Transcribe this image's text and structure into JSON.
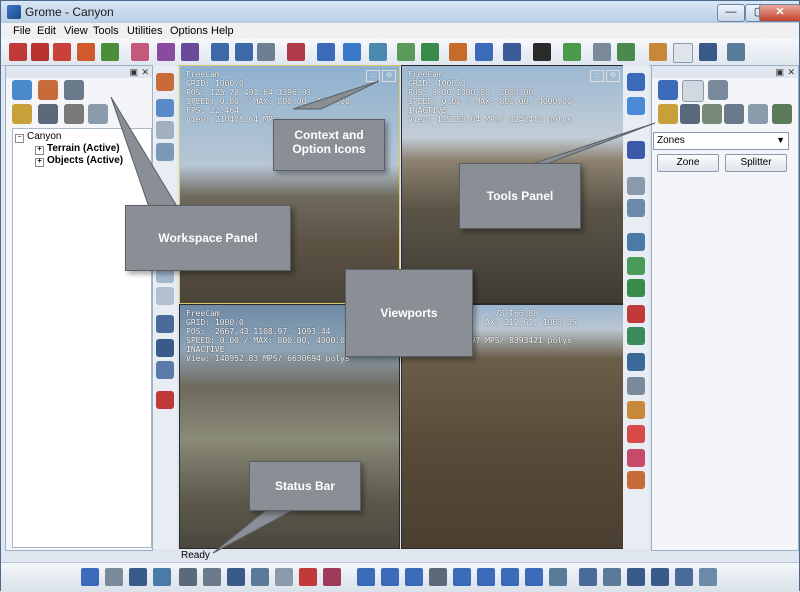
{
  "window": {
    "title": "Grome - Canyon",
    "minimize": "—",
    "maximize": "▢",
    "close": "✕"
  },
  "menu": [
    "File",
    "Edit",
    "View",
    "Tools",
    "Utilities",
    "Options",
    "Help"
  ],
  "workspace": {
    "tree": {
      "root": "Canyon",
      "children": [
        "Terrain (Active)",
        "Objects (Active)"
      ]
    }
  },
  "viewports": [
    {
      "lines": "FreeCam\nGRID: 1000.0\nPOS: 125.78 491.64 1396.93\nSPEED: 0.00 / MAX: 800.00, 4000.00\nFPS: 22.464\nView: 210405.64 MPS/"
    },
    {
      "lines": "FreeCam\nGRID: 1000.0\nPOS: 9.00 1000.00 -2000.00\nSPEED: 0.00 / MAX: 800.00, 4000.00\nINACTIVE\nView: 185158.64 MPS/ 8242410 polys"
    },
    {
      "lines": "FreeCam\nGRID: 1000.0\nPOS: -2667.43 1108.97 -1093.44\nSPEED: 0.00 / MAX: 800.00, 4000.00\nINACTIVE\nView: 148952.83 MPS/ 6630694 polys"
    },
    {
      "lines": "                 .78 166.89\n                AX: 212.61, 1063.05\n\nView: 186083.97 MPS/ 8393421 polys"
    }
  ],
  "tools": {
    "dropdown": "Zones",
    "buttons": [
      "Zone",
      "Splitter"
    ]
  },
  "status": {
    "text": "Ready"
  },
  "callouts": {
    "context": [
      "Context and",
      "Option Icons"
    ],
    "tools": "Tools Panel",
    "workspace": "Workspace Panel",
    "viewports": "Viewports",
    "status": "Status Bar"
  },
  "colors": {
    "accent": "#3a78c8",
    "callout": "#8a8f96",
    "sky": "#8fb1cf"
  }
}
